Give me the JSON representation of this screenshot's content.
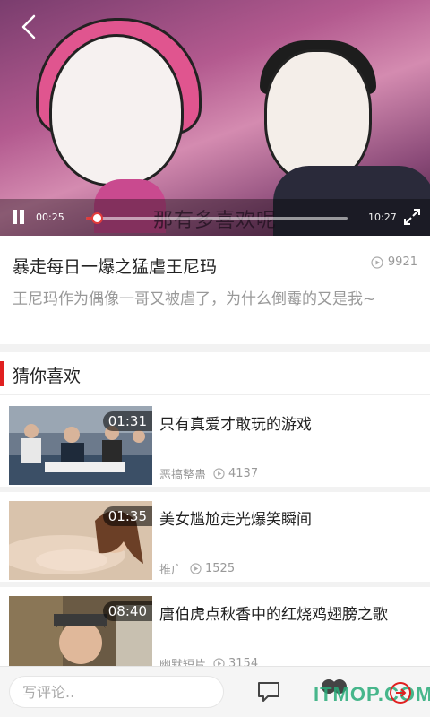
{
  "player": {
    "subtitle": "那有多喜欢呢",
    "current_time": "00:25",
    "total_time": "10:27",
    "progress": 0.04
  },
  "video": {
    "title": "暴走每日一爆之猛虐王尼玛",
    "views": "9921",
    "description": "王尼玛作为偶像一哥又被虐了，为什么倒霉的又是我~"
  },
  "recommend": {
    "section_title": "猜你喜欢",
    "items": [
      {
        "title": "只有真爱才敢玩的游戏",
        "duration": "01:31",
        "category": "恶搞整蛊",
        "views": "4137"
      },
      {
        "title": "美女尴尬走光爆笑瞬间",
        "duration": "01:35",
        "category": "推广",
        "views": "1525"
      },
      {
        "title": "唐伯虎点秋香中的红烧鸡翅膀之歌",
        "duration": "08:40",
        "category": "幽默短片",
        "views": "3154"
      }
    ]
  },
  "bottom_bar": {
    "comment_placeholder": "写评论..",
    "watermark": "ITMOP.COM"
  },
  "colors": {
    "accent": "#e02020",
    "progress": "#e23b3b",
    "muted": "#999999"
  }
}
